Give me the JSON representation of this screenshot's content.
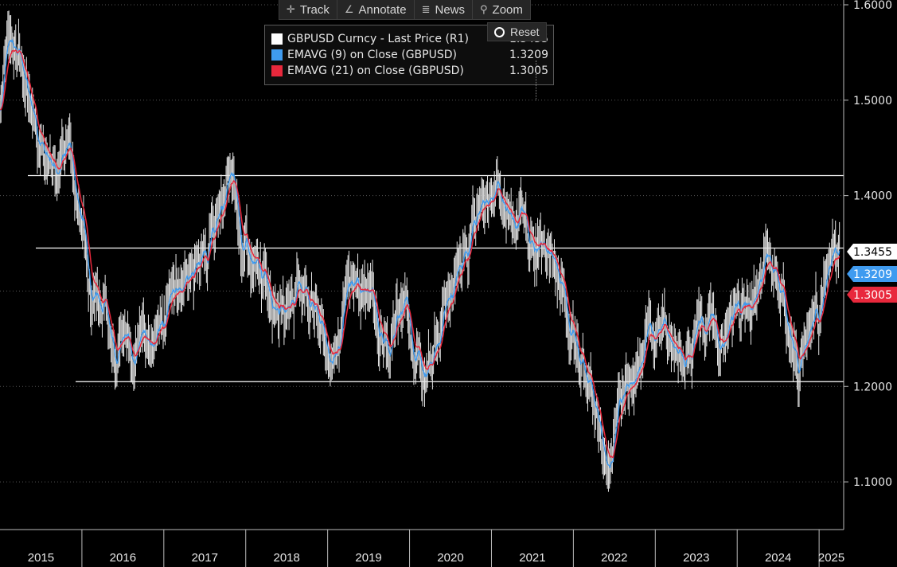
{
  "toolbar": {
    "track": "Track",
    "annotate": "Annotate",
    "news": "News",
    "zoom": "Zoom",
    "reset": "Reset"
  },
  "legend": [
    {
      "label": "GBPUSD Curncy - Last Price (R1)",
      "value": "1.3455",
      "color": "#ffffff"
    },
    {
      "label": "EMAVG (9)  on Close (GBPUSD)",
      "value": "1.3209",
      "color": "#3f9bf0"
    },
    {
      "label": "EMAVG (21)  on Close (GBPUSD)",
      "value": "1.3005",
      "color": "#e8283c"
    }
  ],
  "chart_data": {
    "type": "line",
    "x_labels": [
      "2015",
      "2016",
      "2017",
      "2018",
      "2019",
      "2020",
      "2021",
      "2022",
      "2023",
      "2024",
      "2025"
    ],
    "y_ticks": [
      "1.1000",
      "1.2000",
      "1.3000",
      "1.4000",
      "1.5000",
      "1.6000"
    ],
    "ylim": [
      1.05,
      1.605
    ],
    "x_range": [
      2015.0,
      2025.3
    ],
    "horizontal_lines": [
      1.421,
      1.345,
      1.205
    ],
    "price_points": [
      [
        2015.0,
        1.49
      ],
      [
        2015.05,
        1.55
      ],
      [
        2015.13,
        1.58
      ],
      [
        2015.2,
        1.55
      ],
      [
        2015.3,
        1.53
      ],
      [
        2015.4,
        1.5
      ],
      [
        2015.5,
        1.46
      ],
      [
        2015.55,
        1.42
      ],
      [
        2015.62,
        1.44
      ],
      [
        2015.7,
        1.43
      ],
      [
        2015.78,
        1.45
      ],
      [
        2015.85,
        1.46
      ],
      [
        2015.92,
        1.4
      ],
      [
        2016.0,
        1.38
      ],
      [
        2016.08,
        1.32
      ],
      [
        2016.2,
        1.3
      ],
      [
        2016.3,
        1.28
      ],
      [
        2016.4,
        1.24
      ],
      [
        2016.5,
        1.25
      ],
      [
        2016.6,
        1.23
      ],
      [
        2016.7,
        1.26
      ],
      [
        2016.8,
        1.24
      ],
      [
        2016.9,
        1.26
      ],
      [
        2017.0,
        1.27
      ],
      [
        2017.1,
        1.29
      ],
      [
        2017.2,
        1.31
      ],
      [
        2017.3,
        1.32
      ],
      [
        2017.4,
        1.33
      ],
      [
        2017.5,
        1.34
      ],
      [
        2017.6,
        1.36
      ],
      [
        2017.7,
        1.39
      ],
      [
        2017.8,
        1.42
      ],
      [
        2017.88,
        1.39
      ],
      [
        2017.95,
        1.35
      ],
      [
        2018.05,
        1.33
      ],
      [
        2018.15,
        1.31
      ],
      [
        2018.25,
        1.31
      ],
      [
        2018.35,
        1.3
      ],
      [
        2018.45,
        1.28
      ],
      [
        2018.55,
        1.29
      ],
      [
        2018.65,
        1.31
      ],
      [
        2018.75,
        1.3
      ],
      [
        2018.85,
        1.28
      ],
      [
        2018.95,
        1.25
      ],
      [
        2019.05,
        1.23
      ],
      [
        2019.15,
        1.25
      ],
      [
        2019.25,
        1.3
      ],
      [
        2019.35,
        1.31
      ],
      [
        2019.45,
        1.3
      ],
      [
        2019.55,
        1.29
      ],
      [
        2019.65,
        1.25
      ],
      [
        2019.75,
        1.24
      ],
      [
        2019.85,
        1.27
      ],
      [
        2019.95,
        1.3
      ],
      [
        2020.05,
        1.24
      ],
      [
        2020.15,
        1.22
      ],
      [
        2020.25,
        1.24
      ],
      [
        2020.35,
        1.25
      ],
      [
        2020.45,
        1.29
      ],
      [
        2020.55,
        1.3
      ],
      [
        2020.65,
        1.33
      ],
      [
        2020.75,
        1.36
      ],
      [
        2020.85,
        1.39
      ],
      [
        2020.95,
        1.4
      ],
      [
        2021.05,
        1.41
      ],
      [
        2021.15,
        1.39
      ],
      [
        2021.25,
        1.38
      ],
      [
        2021.35,
        1.38
      ],
      [
        2021.45,
        1.36
      ],
      [
        2021.55,
        1.34
      ],
      [
        2021.65,
        1.35
      ],
      [
        2021.75,
        1.33
      ],
      [
        2021.85,
        1.31
      ],
      [
        2021.95,
        1.27
      ],
      [
        2022.05,
        1.24
      ],
      [
        2022.15,
        1.21
      ],
      [
        2022.25,
        1.2
      ],
      [
        2022.35,
        1.14
      ],
      [
        2022.4,
        1.1
      ],
      [
        2022.45,
        1.13
      ],
      [
        2022.55,
        1.19
      ],
      [
        2022.65,
        1.2
      ],
      [
        2022.75,
        1.21
      ],
      [
        2022.85,
        1.23
      ],
      [
        2022.95,
        1.25
      ],
      [
        2023.05,
        1.27
      ],
      [
        2023.15,
        1.26
      ],
      [
        2023.25,
        1.24
      ],
      [
        2023.35,
        1.23
      ],
      [
        2023.45,
        1.25
      ],
      [
        2023.55,
        1.27
      ],
      [
        2023.65,
        1.26
      ],
      [
        2023.75,
        1.25
      ],
      [
        2023.85,
        1.26
      ],
      [
        2023.95,
        1.27
      ],
      [
        2024.05,
        1.28
      ],
      [
        2024.15,
        1.3
      ],
      [
        2024.25,
        1.32
      ],
      [
        2024.35,
        1.34
      ],
      [
        2024.45,
        1.32
      ],
      [
        2024.55,
        1.29
      ],
      [
        2024.65,
        1.25
      ],
      [
        2024.75,
        1.22
      ],
      [
        2024.85,
        1.26
      ],
      [
        2024.95,
        1.28
      ],
      [
        2025.05,
        1.29
      ],
      [
        2025.15,
        1.33
      ],
      [
        2025.25,
        1.3455
      ]
    ]
  },
  "y_badges": [
    {
      "value": "1.3455",
      "y": 1.3455,
      "bg": "#ffffff",
      "fg": "#000000"
    },
    {
      "value": "1.3209",
      "y": 1.3209,
      "bg": "#3f9bf0",
      "fg": "#ffffff"
    },
    {
      "value": "1.3005",
      "y": 1.3005,
      "bg": "#e8283c",
      "fg": "#ffffff"
    }
  ]
}
